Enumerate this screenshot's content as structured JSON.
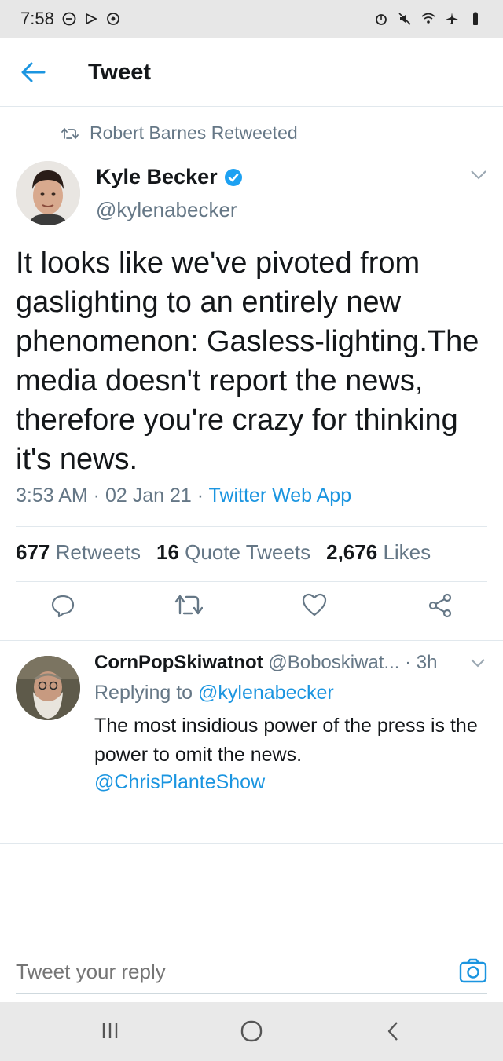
{
  "status_bar": {
    "time": "7:58",
    "left_icons": [
      "do-not-disturb-icon",
      "play-icon",
      "settings-icon"
    ],
    "right_icons": [
      "alarm-icon",
      "mute-icon",
      "wifi-icon",
      "airplane-icon",
      "battery-icon"
    ]
  },
  "app_bar": {
    "title": "Tweet",
    "back_icon": "back-arrow-icon"
  },
  "tweet": {
    "retweeted_by": "Robert Barnes Retweeted",
    "author_name": "Kyle Becker",
    "author_handle": "@kylenabecker",
    "text": "It looks like we've pivoted from gaslighting to an entirely new phenomenon: Gasless-lighting.The media doesn't report the news, therefore you're crazy for thinking it's news.",
    "time": "3:53 AM · 02 Jan 21 · ",
    "source": "Twitter Web App",
    "stats": {
      "retweets_count": "677",
      "retweets_label": "Retweets",
      "quotes_count": "16",
      "quotes_label": "Quote Tweets",
      "likes_count": "2,676",
      "likes_label": "Likes"
    },
    "colors": {
      "link": "#1b95e0",
      "verified": "#1da1f2",
      "muted": "#657786"
    }
  },
  "reply": {
    "name": "CornPopSkiwatnot",
    "handle": "@Boboskiwat...",
    "age": " · 3h",
    "replying_prefix": "Replying to ",
    "replying_to": "@kylenabecker",
    "text": "The most insidious power of the press is the power to omit the news.",
    "mention": "@ChrisPlanteShow"
  },
  "compose": {
    "placeholder": "Tweet your reply"
  },
  "nav": {
    "buttons": [
      "recents-icon",
      "home-icon",
      "back-icon"
    ]
  }
}
